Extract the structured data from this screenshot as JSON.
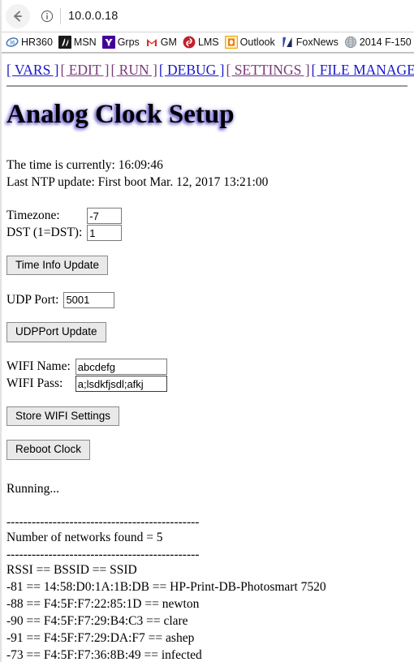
{
  "browser": {
    "back_icon": "back-arrow-icon",
    "info_icon": "info-icon",
    "url": "10.0.0.18",
    "bookmarks": [
      {
        "label": "HR360",
        "icon": "hr360-favicon",
        "color": "#4b7fbe"
      },
      {
        "label": "MSN",
        "icon": "msn-favicon",
        "color": "#1a1a1a"
      },
      {
        "label": "Grps",
        "icon": "yahoo-favicon",
        "color": "#430297"
      },
      {
        "label": "GM",
        "icon": "gmail-favicon",
        "color": "#d93025"
      },
      {
        "label": "LMS",
        "icon": "lms-favicon",
        "color": "#c21f2e"
      },
      {
        "label": "Outlook",
        "icon": "outlook-favicon",
        "color": "#f0a500"
      },
      {
        "label": "FoxNews",
        "icon": "foxnews-favicon",
        "color": "#1b2a5e"
      },
      {
        "label": "2014 F-150",
        "icon": "globe-favicon",
        "color": "#9aa0a6"
      }
    ]
  },
  "nav": {
    "items": [
      {
        "label": "[ VARS ]",
        "state": "unvisited"
      },
      {
        "label": "[ EDIT ]",
        "state": "visited"
      },
      {
        "label": "[ RUN ]",
        "state": "visited"
      },
      {
        "label": "[ DEBUG ]",
        "state": "unvisited"
      },
      {
        "label": "[ SETTINGS ]",
        "state": "visited"
      },
      {
        "label": "[ FILE MANAGER ]",
        "state": "unvisited"
      }
    ]
  },
  "heading": "Analog Clock Setup",
  "status": {
    "current_time_line": "The time is currently: 16:09:46",
    "last_ntp_line": "Last NTP update: First boot Mar. 12, 2017 13:21:00",
    "running": "Running..."
  },
  "time_form": {
    "timezone_label": "Timezone:",
    "timezone_value": "-7",
    "dst_label": "DST (1=DST):",
    "dst_value": "1",
    "submit_label": "Time Info Update"
  },
  "udp_form": {
    "port_label": "UDP Port:",
    "port_value": "5001",
    "submit_label": "UDPPort Update"
  },
  "wifi_form": {
    "name_label": "WIFI Name:",
    "name_value": "abcdefg",
    "pass_label": "WIFI Pass:",
    "pass_value": "a;lsdkfjsdl;afkj",
    "submit_label": "Store WIFI Settings"
  },
  "reboot": {
    "label": "Reboot Clock"
  },
  "scan": {
    "divider_top": "----------------------------------------------",
    "count_line": "Number of networks found = 5",
    "divider_bottom": "----------------------------------------------",
    "header_line": "RSSI == BSSID == SSID",
    "networks": [
      {
        "line": "-81 == 14:58:D0:1A:1B:DB == HP-Print-DB-Photosmart 7520"
      },
      {
        "line": "-88 == F4:5F:F7:22:85:1D == newton"
      },
      {
        "line": "-90 == F4:5F:F7:29:B4:C3 == clare"
      },
      {
        "line": "-91 == F4:5F:F7:29:DA:F7 == ashep"
      },
      {
        "line": "-73 == F4:5F:F7:36:8B:49 == infected"
      }
    ]
  },
  "colors": {
    "link": "#1818c8",
    "link_visited": "#7a3a7a",
    "title_glow": "#7b6fd6",
    "rule": "#9a9a9a"
  }
}
